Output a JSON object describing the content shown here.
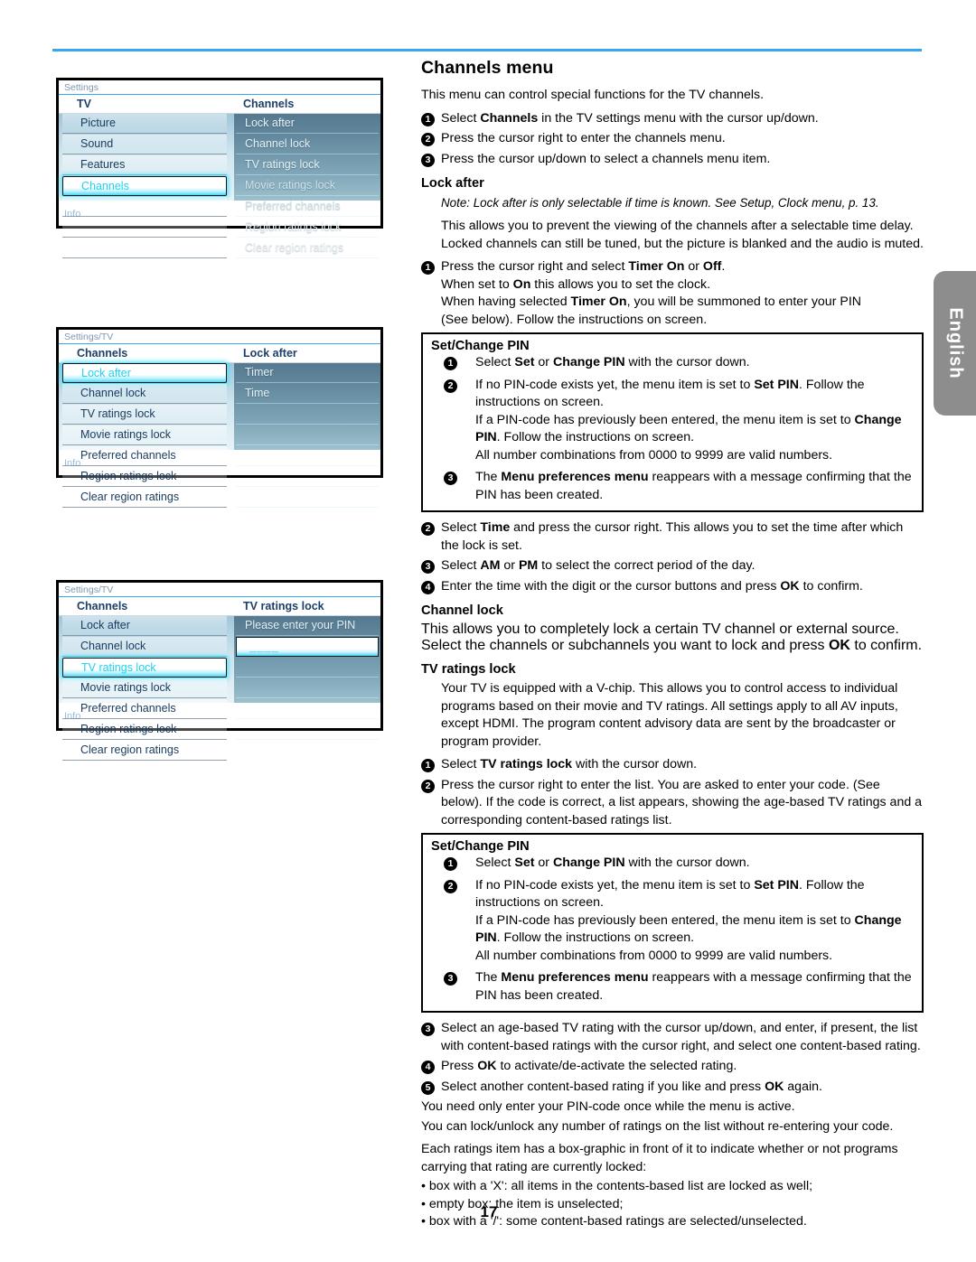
{
  "page": {
    "number": "17",
    "language_tab": "English",
    "accent_blue": "#38a8ee"
  },
  "screenshots": [
    {
      "breadcrumb": "Settings",
      "left_header": "TV",
      "right_header": "Channels",
      "left_items": [
        "Picture",
        "Sound",
        "Features",
        "Channels"
      ],
      "left_selected_index": 3,
      "right_items": [
        "Lock after",
        "Channel lock",
        "TV ratings lock",
        "Movie ratings lock",
        "Preferred channels",
        "Region ratings lock",
        "Clear region ratings"
      ],
      "info": "Info"
    },
    {
      "breadcrumb": "Settings/TV",
      "left_header": "Channels",
      "right_header": "Lock after",
      "left_items": [
        "Lock after",
        "Channel lock",
        "TV ratings lock",
        "Movie ratings lock",
        "Preferred channels",
        "Region ratings lock",
        "Clear region ratings"
      ],
      "left_selected_index": 0,
      "right_items": [
        "Timer",
        "Time"
      ],
      "info": "Info"
    },
    {
      "breadcrumb": "Settings/TV",
      "left_header": "Channels",
      "right_header": "TV ratings lock",
      "left_items": [
        "Lock after",
        "Channel lock",
        "TV ratings lock",
        "Movie ratings lock",
        "Preferred channels",
        "Region ratings lock",
        "Clear region ratings"
      ],
      "left_selected_index": 2,
      "right_items": [
        "Please enter your PIN"
      ],
      "pin_placeholder": "____",
      "info": "Info"
    }
  ],
  "content": {
    "title": "Channels menu",
    "intro": "This menu can control special functions for the TV channels.",
    "intro_steps": [
      "Select Channels in the TV settings menu with the cursor up/down.",
      "Press the cursor right to enter the channels menu.",
      "Press the cursor up/down to select a channels menu item."
    ],
    "lock_after": {
      "heading": "Lock after",
      "note": "Note: Lock after is only selectable if time is known. See Setup, Clock menu, p. 13.",
      "paragraph": "This allows you to prevent the viewing of the channels after a selectable time delay. Locked channels can still be tuned, but the picture is blanked and the audio is muted.",
      "step1": "Press the cursor right and select Timer On or Off.",
      "step1_line2": "When set to On this allows you to set the clock.",
      "step1_line3": "When having selected Timer On, you will be summoned to enter your PIN",
      "step1_line4": "(See below). Follow the instructions on screen.",
      "step2": "Select Time and press the cursor right. This allows you to set the time after which the lock is set.",
      "step3": "Select AM or PM to select the correct period of the day.",
      "step4": "Enter the time with the digit or the cursor buttons and press OK to confirm."
    },
    "pin_box": {
      "title": "Set/Change PIN",
      "step1": "Select Set or Change PIN with the cursor down.",
      "step2_line1": "If no PIN-code exists yet, the menu item is set to Set PIN. Follow the instructions on screen.",
      "step2_line2": "If a PIN-code has previously been entered, the menu item is set to Change PIN. Follow the instructions on screen.",
      "step2_line3": "All number combinations from 0000 to 9999 are valid numbers.",
      "step3": "The Menu preferences menu reappears with a message confirming that the PIN has been created."
    },
    "channel_lock": {
      "heading": "Channel lock",
      "paragraph": "This allows you to completely lock a certain TV channel or external source. Select the channels or subchannels you want to lock and press OK to confirm."
    },
    "tv_ratings_lock": {
      "heading": "TV ratings lock",
      "paragraph": "Your TV is equipped with a V-chip. This allows you to control access to individual programs based on their movie and TV ratings. All settings apply to all AV inputs, except HDMI. The program content advisory data are sent by the broadcaster or program provider.",
      "step1": "Select TV ratings lock with the cursor down.",
      "step2": "Press the cursor right to enter the list. You are asked to enter your code. (See below). If the code is correct, a list appears, showing the age-based TV ratings and a corresponding content-based ratings list.",
      "step3": "Select an age-based TV rating with the cursor up/down, and enter, if present, the list with content-based ratings with the cursor right, and select one content-based rating.",
      "step4": "Press OK to activate/de-activate the selected rating.",
      "step5": "Select another content-based rating if you like and press OK again.",
      "closing_line1": "You need only enter your PIN-code once while the menu is active.",
      "closing_line2": "You can lock/unlock any number of ratings on the list without re-entering your code.",
      "closing_line3": "Each ratings item has a box-graphic in front of it to indicate whether or not programs carrying that rating are currently locked:",
      "bullets": [
        "• box with a 'X': all items in the contents-based list are locked as well;",
        "• empty box: the item is unselected;",
        "• box with a '/': some content-based ratings are selected/unselected."
      ]
    }
  }
}
